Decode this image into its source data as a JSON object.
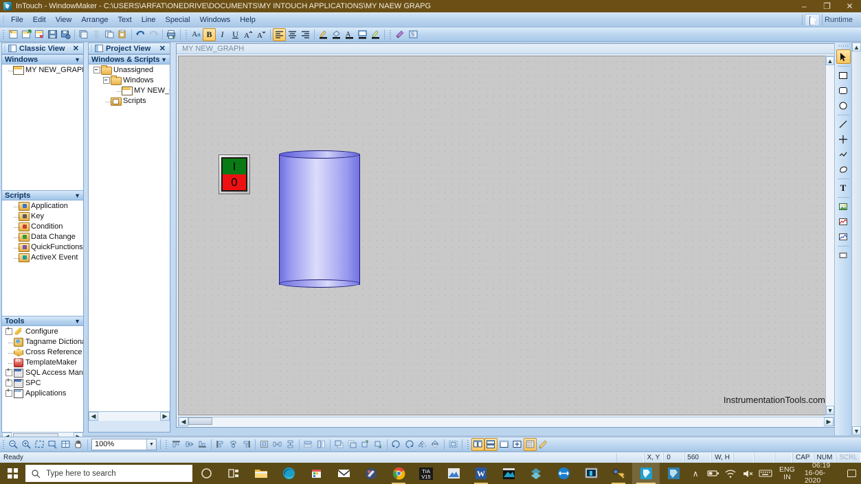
{
  "window": {
    "title": "InTouch - WindowMaker - C:\\USERS\\ARFAT\\ONEDRIVE\\DOCUMENTS\\MY INTOUCH APPLICATIONS\\MY NAEW GRAPG",
    "app_icon": "intouch-icon",
    "minimize": "–",
    "maximize": "❐",
    "close": "✕"
  },
  "menu": {
    "items": [
      {
        "label": "File"
      },
      {
        "label": "Edit"
      },
      {
        "label": "View"
      },
      {
        "label": "Arrange"
      },
      {
        "label": "Text"
      },
      {
        "label": "Line"
      },
      {
        "label": "Special"
      },
      {
        "label": "Windows"
      },
      {
        "label": "Help"
      }
    ],
    "runtime_label": "Runtime",
    "runtime_icon": "runtime-arrow-icon"
  },
  "toolbar": {
    "groups": [
      {
        "buttons": [
          {
            "name": "new-window-icon"
          },
          {
            "name": "open-window-icon"
          },
          {
            "name": "close-window-icon"
          },
          {
            "name": "save-icon"
          },
          {
            "name": "save-all-icon"
          }
        ]
      },
      {
        "buttons": [
          {
            "name": "cut-icon"
          },
          {
            "name": "copy-icon",
            "disabled": true
          },
          {
            "name": "paste-icon"
          },
          {
            "name": "duplicate-icon"
          }
        ]
      },
      {
        "buttons": [
          {
            "name": "undo-icon"
          },
          {
            "name": "redo-icon",
            "disabled": true
          }
        ]
      },
      {
        "buttons": [
          {
            "name": "print-icon"
          }
        ]
      },
      {
        "buttons": [
          {
            "name": "font-icon",
            "glyph": "A"
          },
          {
            "name": "bold-icon",
            "glyph": "B",
            "active": true
          },
          {
            "name": "italic-icon",
            "glyph": "I"
          },
          {
            "name": "underline-icon",
            "glyph": "U"
          },
          {
            "name": "increase-font-size-icon",
            "glyph": "A˄"
          },
          {
            "name": "decrease-font-size-icon",
            "glyph": "A˅"
          }
        ]
      },
      {
        "buttons": [
          {
            "name": "align-left-icon",
            "active": true
          },
          {
            "name": "align-center-icon"
          },
          {
            "name": "align-right-icon"
          }
        ]
      },
      {
        "buttons": [
          {
            "name": "line-color-icon"
          },
          {
            "name": "fill-color-icon"
          },
          {
            "name": "text-color-icon"
          },
          {
            "name": "window-color-icon"
          },
          {
            "name": "highlight-color-icon"
          }
        ]
      },
      {
        "buttons": [
          {
            "name": "substitute-tags-icon"
          },
          {
            "name": "substitute-strings-icon"
          }
        ]
      }
    ]
  },
  "classic_view": {
    "panel_title": "Classic View",
    "close_label": "✕",
    "sections": [
      {
        "header": "Windows",
        "caret": "▼",
        "items": [
          {
            "label": "MY NEW_GRAPH",
            "icon": "window-icon"
          }
        ]
      },
      {
        "header": "Scripts",
        "caret": "▼",
        "items": [
          {
            "label": "Application",
            "icon": "script-application-icon"
          },
          {
            "label": "Key",
            "icon": "script-key-icon"
          },
          {
            "label": "Condition",
            "icon": "script-condition-icon"
          },
          {
            "label": "Data Change",
            "icon": "script-datachange-icon"
          },
          {
            "label": "QuickFunctions",
            "icon": "script-quickfunctions-icon"
          },
          {
            "label": "ActiveX Event",
            "icon": "script-activex-icon"
          }
        ]
      },
      {
        "header": "Tools",
        "caret": "▼",
        "items": [
          {
            "label": "Configure",
            "icon": "wrench-icon",
            "expandable": true
          },
          {
            "label": "Tagname Dictiona",
            "icon": "tagname-dictionary-icon"
          },
          {
            "label": "Cross Reference",
            "icon": "cross-reference-icon"
          },
          {
            "label": "TemplateMaker",
            "icon": "template-maker-icon"
          },
          {
            "label": "SQL Access Mana",
            "icon": "sql-access-icon",
            "expandable": true
          },
          {
            "label": "SPC",
            "icon": "spc-icon",
            "expandable": true
          },
          {
            "label": "Applications",
            "icon": "applications-icon",
            "expandable": true
          }
        ]
      }
    ]
  },
  "project_view": {
    "panel_title": "Project View",
    "close_label": "✕",
    "header": "Windows & Scripts",
    "caret": "▼",
    "tree": [
      {
        "label": "Unassigned",
        "icon": "folder-icon",
        "depth": 0,
        "toggle": "expanded"
      },
      {
        "label": "Windows",
        "icon": "folder-icon",
        "depth": 1,
        "toggle": "expanded"
      },
      {
        "label": "MY NEW_G",
        "icon": "window-icon",
        "depth": 2,
        "toggle": "none"
      },
      {
        "label": "Scripts",
        "icon": "scripts-folder-icon",
        "depth": 1,
        "toggle": "none"
      }
    ]
  },
  "canvas": {
    "window_title": "MY NEW_GRAPH",
    "watermark": "InstrumentationTools.com",
    "objects": [
      {
        "name": "toggle-switch",
        "type": "switch",
        "on_label": "I",
        "off_label": "0",
        "on_color": "#0a7a16",
        "off_color": "#ee1111"
      },
      {
        "name": "tank-cylinder",
        "type": "cylinder",
        "fill_color": "#a9a9f2",
        "outline_color": "#1b1b7a"
      }
    ]
  },
  "tool_palette": {
    "buttons": [
      {
        "name": "select-pointer-tool",
        "active": true
      },
      {
        "name": "rectangle-tool"
      },
      {
        "name": "rounded-rectangle-tool"
      },
      {
        "name": "ellipse-tool"
      },
      {
        "name": "line-tool"
      },
      {
        "name": "polyline-tool"
      },
      {
        "name": "polygon-tool"
      },
      {
        "name": "freehand-tool"
      },
      {
        "name": "text-tool"
      },
      {
        "name": "bitmap-tool"
      },
      {
        "name": "realtime-trend-tool"
      },
      {
        "name": "historical-trend-tool"
      },
      {
        "name": "button-tool"
      }
    ]
  },
  "bottom_toolbar": {
    "zoom_value": "100%",
    "zoom_caret": "▼",
    "groups": [
      {
        "buttons": [
          {
            "name": "zoom-out-icon"
          },
          {
            "name": "zoom-in-icon"
          },
          {
            "name": "zoom-to-fit-icon"
          },
          {
            "name": "zoom-selection-icon"
          },
          {
            "name": "zoom-window-icon"
          },
          {
            "name": "pan-hand-icon"
          }
        ]
      },
      {
        "buttons": [
          {
            "name": "align-top-icon"
          },
          {
            "name": "align-middle-icon"
          },
          {
            "name": "align-bottom-icon"
          }
        ]
      },
      {
        "buttons": [
          {
            "name": "align-left-edges-icon"
          },
          {
            "name": "align-center-vertical-icon"
          },
          {
            "name": "align-right-edges-icon"
          }
        ]
      },
      {
        "buttons": [
          {
            "name": "center-icon"
          },
          {
            "name": "space-horizontal-icon"
          },
          {
            "name": "space-vertical-icon"
          }
        ]
      },
      {
        "buttons": [
          {
            "name": "make-same-width-icon"
          },
          {
            "name": "make-same-height-icon"
          }
        ]
      },
      {
        "buttons": [
          {
            "name": "bring-to-front-icon"
          },
          {
            "name": "send-to-back-icon"
          },
          {
            "name": "bring-forward-icon"
          },
          {
            "name": "send-backward-icon"
          }
        ]
      },
      {
        "buttons": [
          {
            "name": "rotate-left-icon"
          },
          {
            "name": "rotate-right-icon"
          },
          {
            "name": "flip-horizontal-icon"
          },
          {
            "name": "flip-vertical-icon"
          }
        ]
      },
      {
        "buttons": [
          {
            "name": "group-icon"
          }
        ]
      },
      {
        "buttons": [
          {
            "name": "tile-vertical-icon",
            "active": true
          },
          {
            "name": "tile-horizontal-icon",
            "active": true
          },
          {
            "name": "window-mode-icon"
          },
          {
            "name": "fullscreen-icon"
          },
          {
            "name": "show-grid-icon",
            "active": true
          },
          {
            "name": "snap-to-grid-icon"
          }
        ]
      }
    ]
  },
  "statusbar": {
    "ready": "Ready",
    "cells": [
      {
        "label": "",
        "name": "status-spacer-1"
      },
      {
        "label": "X, Y",
        "name": "coordinates-label"
      },
      {
        "label": "0",
        "name": "coordinate-x-value"
      },
      {
        "label": "560",
        "name": "coordinate-y-value"
      },
      {
        "label": "W, H",
        "name": "size-label"
      },
      {
        "label": "",
        "name": "width-value"
      },
      {
        "label": "",
        "name": "height-value"
      },
      {
        "label": "",
        "name": "status-spacer-2"
      },
      {
        "label": "CAP",
        "name": "caps-lock-indicator"
      },
      {
        "label": "NUM",
        "name": "num-lock-indicator"
      },
      {
        "label": "SCRL",
        "name": "scroll-lock-indicator",
        "dim": true
      }
    ]
  },
  "taskbar": {
    "start_icon": "windows-start-icon",
    "search_placeholder": "Type here to search",
    "search_icon": "search-icon",
    "pinned": [
      {
        "name": "cortana-icon"
      },
      {
        "name": "task-view-icon"
      },
      {
        "name": "file-explorer-icon"
      },
      {
        "name": "microsoft-edge-icon"
      },
      {
        "name": "microsoft-store-icon"
      },
      {
        "name": "mail-icon"
      },
      {
        "name": "paint-3d-icon"
      },
      {
        "name": "google-chrome-icon",
        "running": true
      },
      {
        "name": "tia-portal-v15-icon",
        "label_top": "TIA",
        "label_bottom": "V15"
      },
      {
        "name": "photo-viewer-icon"
      },
      {
        "name": "microsoft-word-icon",
        "running": true,
        "glyph": "W"
      },
      {
        "name": "media-player-icon"
      },
      {
        "name": "sublime-text-icon"
      },
      {
        "name": "teamviewer-icon"
      },
      {
        "name": "remote-desktop-icon"
      },
      {
        "name": "key-tool-icon",
        "running": true
      },
      {
        "name": "intouch-windowmaker-icon",
        "active": true
      },
      {
        "name": "intouch-windowviewer-icon"
      }
    ],
    "tray": {
      "chevron": "∧",
      "battery_icon": "battery-icon",
      "wifi_icon": "wifi-icon",
      "volume_icon": "volume-muted-icon",
      "keyboard_icon": "keyboard-icon",
      "language_top": "ENG",
      "language_bottom": "IN",
      "time": "06:19",
      "date": "16-06-2020",
      "notifications_icon": "action-center-icon"
    }
  }
}
